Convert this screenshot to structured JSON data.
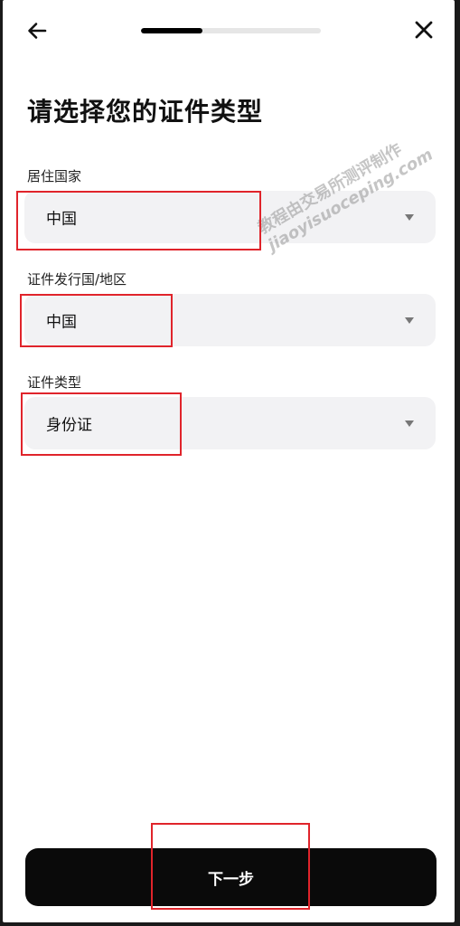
{
  "header": {
    "back_icon": "arrow-left-icon",
    "close_icon": "close-icon",
    "progress_percent": 34
  },
  "title": "请选择您的证件类型",
  "fields": {
    "residence": {
      "label": "居住国家",
      "value": "中国"
    },
    "issuer": {
      "label": "证件发行国/地区",
      "value": "中国"
    },
    "doc_type": {
      "label": "证件类型",
      "value": "身份证"
    }
  },
  "watermark": {
    "line1": "教程由交易所测评制作",
    "line2": "jiaoyisuoceping.com"
  },
  "footer": {
    "next_label": "下一步"
  },
  "colors": {
    "highlight": "#e0242b",
    "field_bg": "#f2f2f4",
    "button_bg": "#0a0a0a"
  }
}
